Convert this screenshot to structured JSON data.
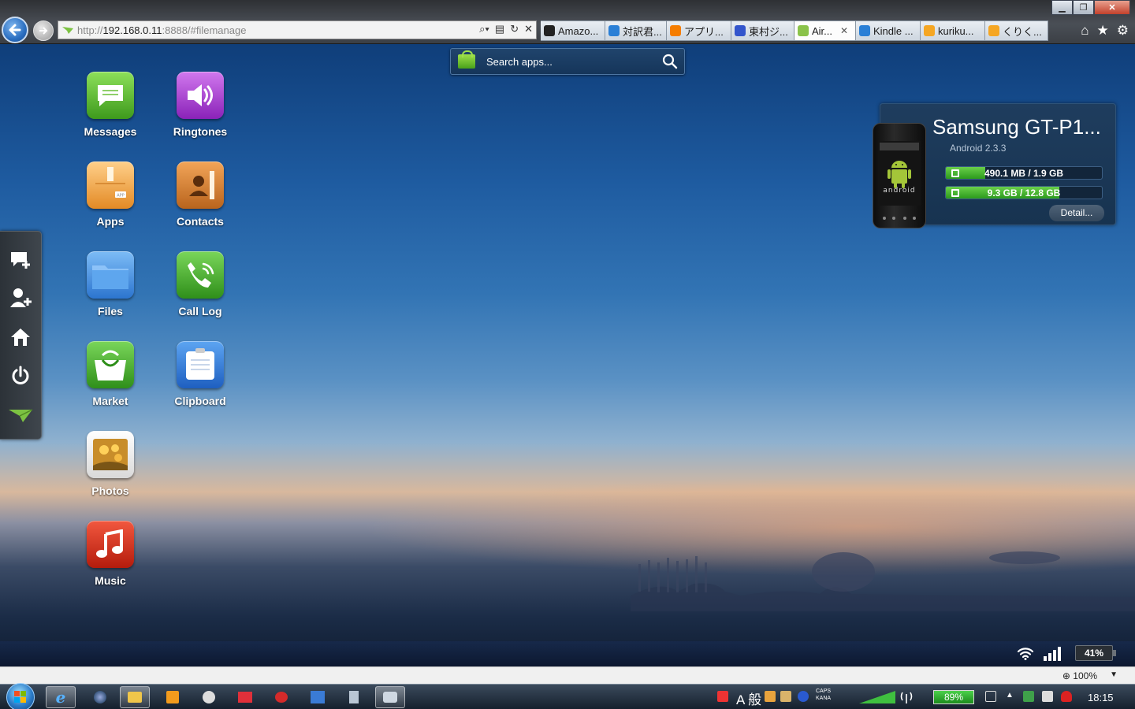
{
  "browser": {
    "address": {
      "prefix": "http://",
      "host": "192.168.0.11",
      "rest": ":8888/#filemanage"
    },
    "tabs": [
      {
        "label": "Amazo...",
        "icon": "amazon-icon",
        "color": "#222222"
      },
      {
        "label": "対訳君...",
        "icon": "ie-page-icon",
        "color": "#2a7fd6"
      },
      {
        "label": "アプリ...",
        "icon": "blogger-icon",
        "color": "#f57d00"
      },
      {
        "label": "東村ジ...",
        "icon": "page-icon",
        "color": "#3355cc"
      },
      {
        "label": "Air...",
        "icon": "airdroid-icon",
        "color": "#8bc34a",
        "active": true
      },
      {
        "label": "Kindle ...",
        "icon": "ie-page-icon",
        "color": "#2a7fd6"
      },
      {
        "label": "kuriku...",
        "icon": "s-icon",
        "color": "#f5a623"
      },
      {
        "label": "くりく...",
        "icon": "s-icon",
        "color": "#f5a623"
      }
    ]
  },
  "search": {
    "placeholder": "Search apps..."
  },
  "apps": [
    {
      "key": "messages",
      "label": "Messages",
      "color": "#5cbf2a"
    },
    {
      "key": "ringtones",
      "label": "Ringtones",
      "color": "#a53fd0"
    },
    {
      "key": "apps",
      "label": "Apps",
      "color": "#f0a23c"
    },
    {
      "key": "contacts",
      "label": "Contacts",
      "color": "#d9852b"
    },
    {
      "key": "files",
      "label": "Files",
      "color": "#3f8fe0"
    },
    {
      "key": "call-log",
      "label": "Call Log",
      "color": "#4caf30"
    },
    {
      "key": "market",
      "label": "Market",
      "color": "#59b52a"
    },
    {
      "key": "clipboard",
      "label": "Clipboard",
      "color": "#2e6fd0"
    },
    {
      "key": "photos",
      "label": "Photos",
      "color": "#f2f2f2"
    },
    {
      "key": "music",
      "label": "Music",
      "color": "#d8301d"
    }
  ],
  "device": {
    "name": "Samsung GT-P1...",
    "os": "Android 2.3.3",
    "phone_brand_text": "android",
    "storage": [
      {
        "label": "490.1 MB / 1.9 GB",
        "used_fraction": 0.252,
        "kind": "internal"
      },
      {
        "label": "9.3 GB / 12.8 GB",
        "used_fraction": 0.727,
        "kind": "sd-card"
      }
    ],
    "detail_label": "Detail..."
  },
  "phone_status": {
    "battery": "41%"
  },
  "ie_status": {
    "zoom": "100%"
  },
  "taskbar": {
    "battery": "89%",
    "clock": "18:15",
    "ime": "A 般",
    "caps": "CAPS",
    "kana": "KANA"
  }
}
